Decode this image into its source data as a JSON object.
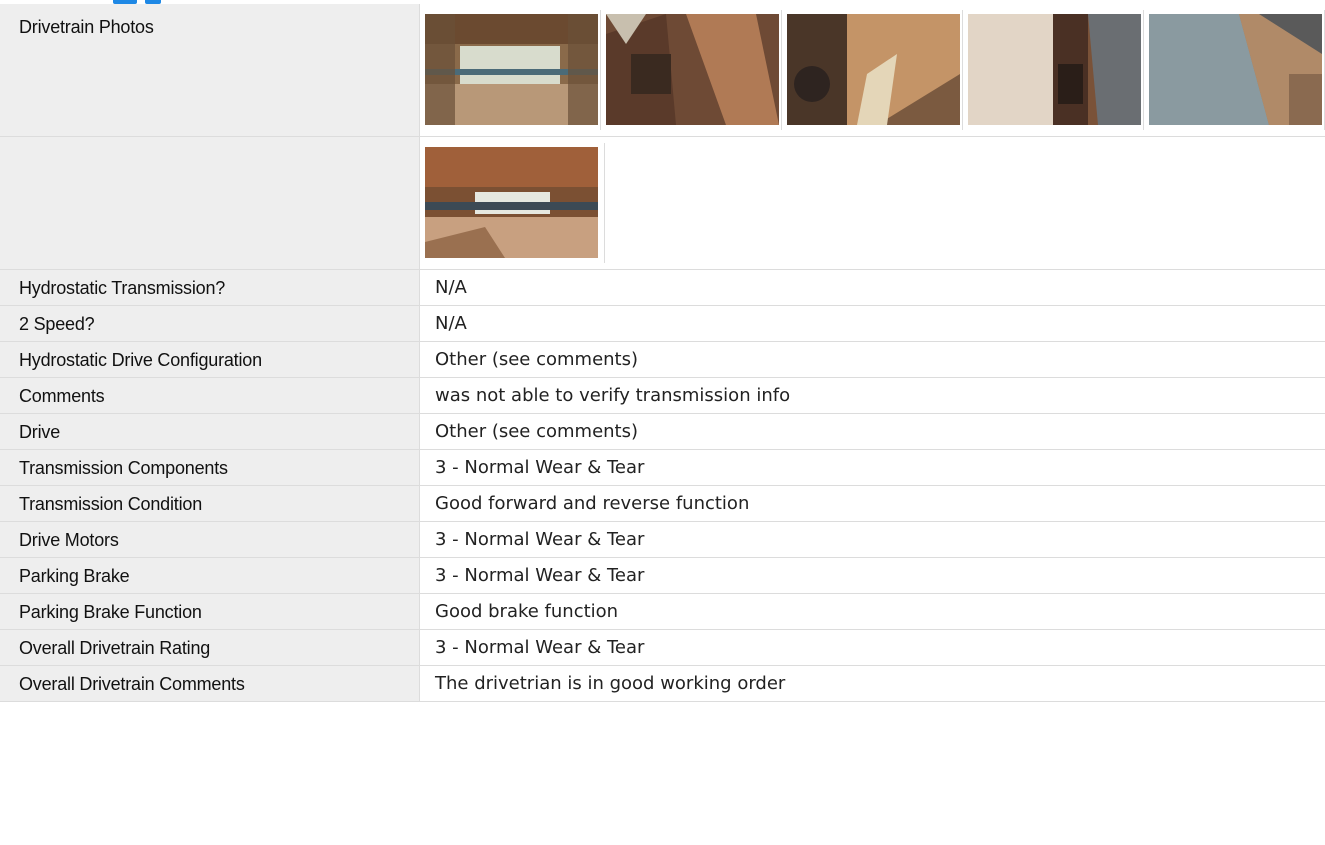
{
  "header": {
    "accent_color": "#1e88e5"
  },
  "photos_section": {
    "label": "Drivetrain Photos",
    "row1": [
      {
        "name": "photo-undercarriage-tunnel"
      },
      {
        "name": "photo-track-frame-closeup"
      },
      {
        "name": "photo-drive-motor-area"
      },
      {
        "name": "photo-side-panel"
      },
      {
        "name": "photo-track-guard"
      }
    ],
    "row2": [
      {
        "name": "photo-undercarriage-rear"
      }
    ]
  },
  "rows": [
    {
      "label": "Hydrostatic Transmission?",
      "value": "N/A"
    },
    {
      "label": "2 Speed?",
      "value": "N/A"
    },
    {
      "label": "Hydrostatic Drive Configuration",
      "value": "Other (see comments)"
    },
    {
      "label": "Comments",
      "value": "was not able to verify transmission info"
    },
    {
      "label": "Drive",
      "value": "Other (see comments)"
    },
    {
      "label": "Transmission Components",
      "value": "3 - Normal Wear & Tear"
    },
    {
      "label": "Transmission Condition",
      "value": "Good forward and reverse function"
    },
    {
      "label": "Drive Motors",
      "value": "3 - Normal Wear & Tear"
    },
    {
      "label": "Parking Brake",
      "value": "3 - Normal Wear & Tear"
    },
    {
      "label": "Parking Brake Function",
      "value": "Good brake function"
    },
    {
      "label": "Overall Drivetrain Rating",
      "value": "3 - Normal Wear & Tear"
    },
    {
      "label": "Overall Drivetrain Comments",
      "value": "The drivetrian is in good working order"
    }
  ]
}
